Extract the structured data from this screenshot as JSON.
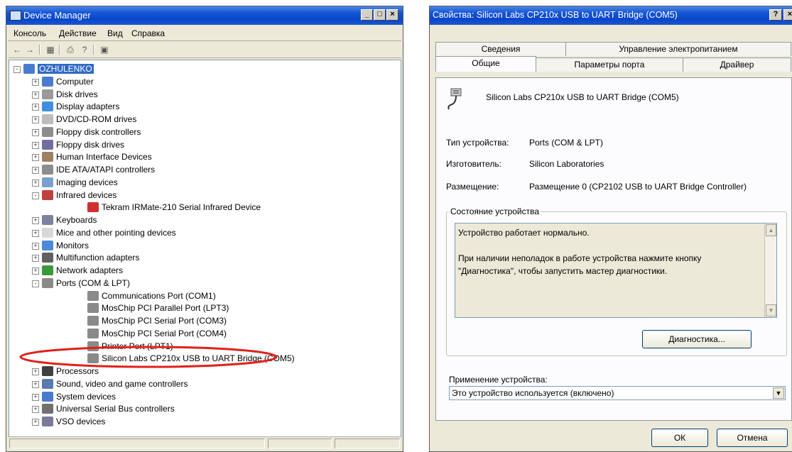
{
  "device_manager": {
    "title": "Device Manager",
    "menu": [
      "Консоль",
      "Действие",
      "Вид",
      "Справка"
    ],
    "tree": [
      {
        "label": "OZHULENKO",
        "level": 0,
        "exp": "-",
        "icon": "computer-icon",
        "selected": true
      },
      {
        "label": "Computer",
        "level": 1,
        "exp": "+",
        "icon": "computer-icon"
      },
      {
        "label": "Disk drives",
        "level": 1,
        "exp": "+",
        "icon": "disk-drive-icon"
      },
      {
        "label": "Display adapters",
        "level": 1,
        "exp": "+",
        "icon": "display-icon"
      },
      {
        "label": "DVD/CD-ROM drives",
        "level": 1,
        "exp": "+",
        "icon": "cdrom-icon"
      },
      {
        "label": "Floppy disk controllers",
        "level": 1,
        "exp": "+",
        "icon": "controller-icon"
      },
      {
        "label": "Floppy disk drives",
        "level": 1,
        "exp": "+",
        "icon": "floppy-icon"
      },
      {
        "label": "Human Interface Devices",
        "level": 1,
        "exp": "+",
        "icon": "hid-icon"
      },
      {
        "label": "IDE ATA/ATAPI controllers",
        "level": 1,
        "exp": "+",
        "icon": "controller-icon"
      },
      {
        "label": "Imaging devices",
        "level": 1,
        "exp": "+",
        "icon": "camera-icon"
      },
      {
        "label": "Infrared devices",
        "level": 1,
        "exp": "-",
        "icon": "infrared-icon"
      },
      {
        "label": "Tekram IRMate-210 Serial Infrared Device",
        "level": 2,
        "exp": "",
        "icon": "infrared-device-icon"
      },
      {
        "label": "Keyboards",
        "level": 1,
        "exp": "+",
        "icon": "keyboard-icon"
      },
      {
        "label": "Mice and other pointing devices",
        "level": 1,
        "exp": "+",
        "icon": "mouse-icon"
      },
      {
        "label": "Monitors",
        "level": 1,
        "exp": "+",
        "icon": "monitor-icon"
      },
      {
        "label": "Multifunction adapters",
        "level": 1,
        "exp": "+",
        "icon": "multifunction-icon"
      },
      {
        "label": "Network adapters",
        "level": 1,
        "exp": "+",
        "icon": "network-icon"
      },
      {
        "label": "Ports (COM & LPT)",
        "level": 1,
        "exp": "-",
        "icon": "port-icon"
      },
      {
        "label": "Communications Port (COM1)",
        "level": 2,
        "exp": "",
        "icon": "port-icon"
      },
      {
        "label": "MosChip PCI Parallel Port (LPT3)",
        "level": 2,
        "exp": "",
        "icon": "port-icon"
      },
      {
        "label": "MosChip PCI Serial Port (COM3)",
        "level": 2,
        "exp": "",
        "icon": "port-icon"
      },
      {
        "label": "MosChip PCI Serial Port (COM4)",
        "level": 2,
        "exp": "",
        "icon": "port-icon"
      },
      {
        "label": "Printer Port (LPT1)",
        "level": 2,
        "exp": "",
        "icon": "port-icon"
      },
      {
        "label": "Silicon Labs CP210x USB to UART Bridge (COM5)",
        "level": 2,
        "exp": "",
        "icon": "port-icon",
        "highlighted": true
      },
      {
        "label": "Processors",
        "level": 1,
        "exp": "+",
        "icon": "processor-icon"
      },
      {
        "label": "Sound, video and game controllers",
        "level": 1,
        "exp": "+",
        "icon": "sound-icon"
      },
      {
        "label": "System devices",
        "level": 1,
        "exp": "+",
        "icon": "system-icon"
      },
      {
        "label": "Universal Serial Bus controllers",
        "level": 1,
        "exp": "+",
        "icon": "usb-icon"
      },
      {
        "label": "VSO devices",
        "level": 1,
        "exp": "+",
        "icon": "vso-icon"
      }
    ]
  },
  "properties": {
    "title": "Свойства: Silicon Labs CP210x USB to UART Bridge (COM5)",
    "help_btn": "?",
    "close_btn": "×",
    "tabs_row1": [
      "Сведения",
      "Управление электропитанием"
    ],
    "tabs_row2": [
      "Общие",
      "Параметры порта",
      "Драйвер"
    ],
    "device_name": "Silicon Labs CP210x USB to UART Bridge (COM5)",
    "type_label": "Тип устройства:",
    "type_value": "Ports (COM & LPT)",
    "mfr_label": "Изготовитель:",
    "mfr_value": "Silicon Laboratories",
    "loc_label": "Размещение:",
    "loc_value": "Размещение 0 (CP2102 USB to UART Bridge Controller)",
    "status_group": "Состояние устройства",
    "status_line1": "Устройство работает нормально.",
    "status_line2": "При наличии неполадок в работе устройства нажмите кнопку",
    "status_line3": "\"Диагностика\", чтобы запустить мастер диагностики.",
    "diag_button": "Диагностика...",
    "usage_label": "Применение устройства:",
    "usage_value": "Это устройство используется (включено)",
    "ok_button": "ОК",
    "cancel_button": "Отмена"
  },
  "colors": {
    "highlight_ellipse": "#e0201a",
    "titlebar": "#0a46c8",
    "selection": "#316ac5"
  }
}
